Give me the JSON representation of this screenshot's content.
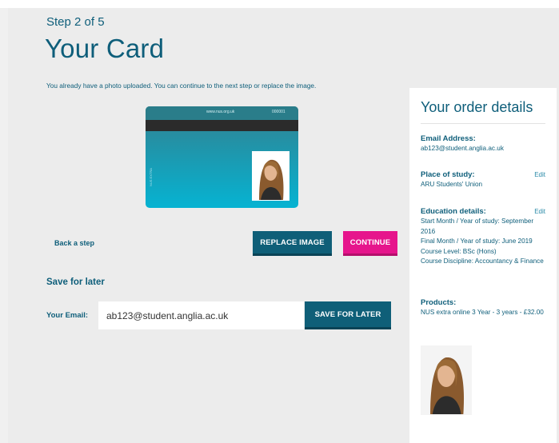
{
  "header": {
    "step": "Step 2 of 5",
    "title": "Your Card",
    "info": "You already have a photo uploaded. You can continue to the next step or replace the image."
  },
  "card": {
    "url": "www.nus.org.uk",
    "number": "000001",
    "side_text": "NUS EXTRA",
    "colors": {
      "gradient_top": "#35808f",
      "gradient_bottom": "#06b3d2",
      "strip": "#2b2b2b"
    }
  },
  "actions": {
    "back_label": "Back a step",
    "replace_label": "REPLACE IMAGE",
    "continue_label": "CONTINUE"
  },
  "save_for_later": {
    "heading": "Save for later",
    "email_label": "Your Email:",
    "email_value": "ab123@student.anglia.ac.uk",
    "button_label": "SAVE FOR LATER"
  },
  "order": {
    "title": "Your order details",
    "email_label": "Email Address:",
    "email_value": "ab123@student.anglia.ac.uk",
    "place_label": "Place of study:",
    "place_value": "ARU Students' Union",
    "place_edit": "Edit",
    "education_label": "Education details:",
    "education_edit": "Edit",
    "education_lines": [
      "Start Month / Year of study: September 2016",
      "Final Month / Year of study: June 2019",
      "Course Level: BSc (Hons)",
      "Course Discipline: Accountancy & Finance"
    ],
    "products_label": "Products:",
    "products_value": "NUS extra online 3 Year - 3 years - £32.00"
  },
  "colors": {
    "brand": "#0e5e7a",
    "primary_button": "#0f5f78",
    "accent_button": "#e6158c",
    "background": "#ececec"
  }
}
